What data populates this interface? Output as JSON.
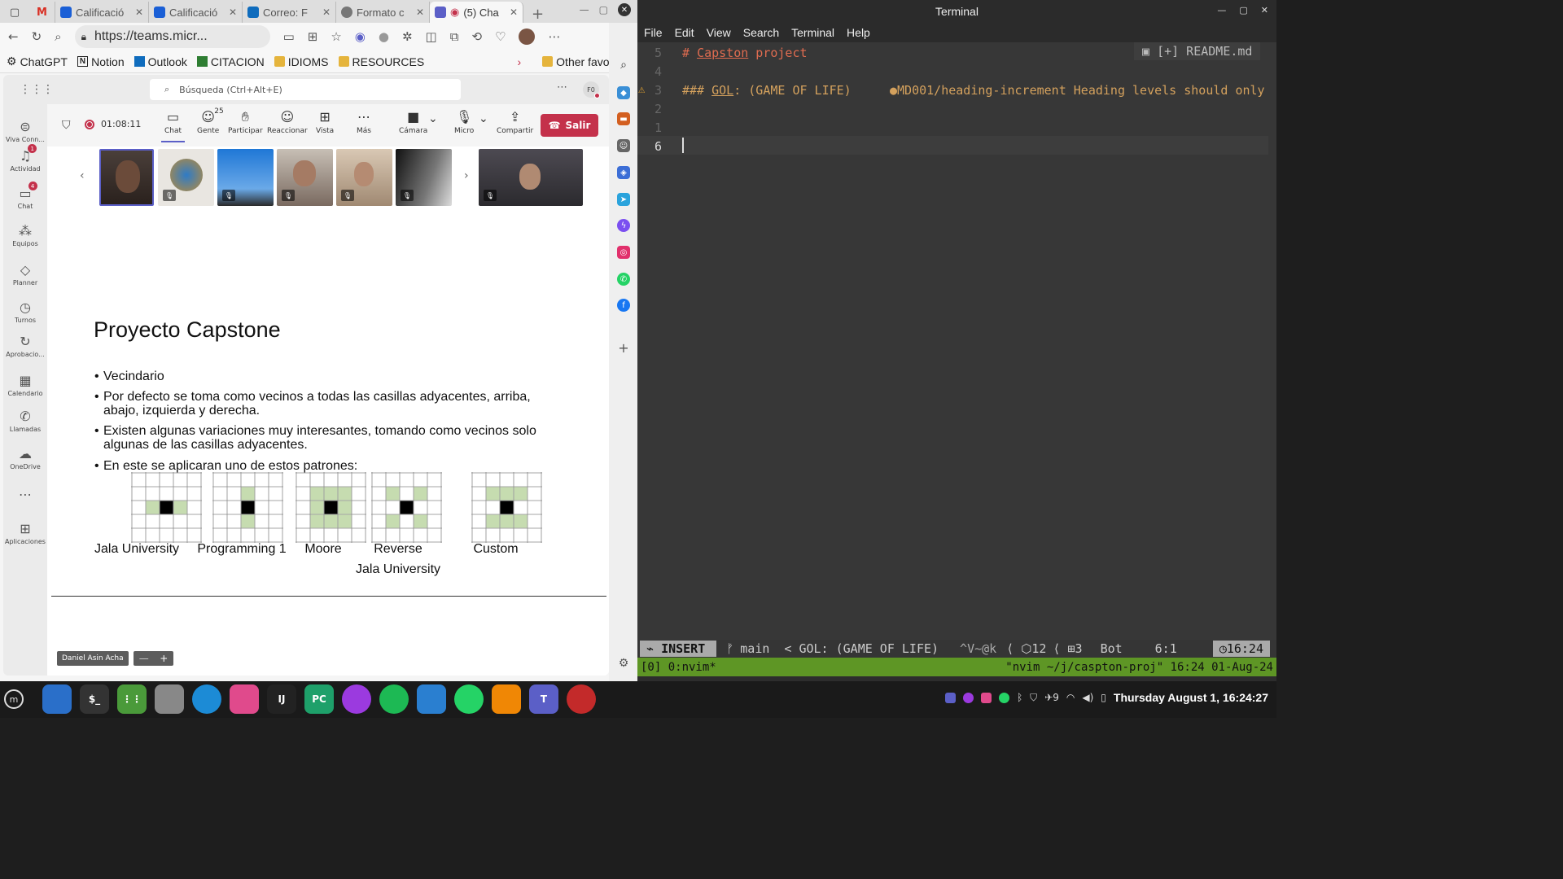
{
  "browser": {
    "tabs": [
      {
        "label": "Calificació",
        "color": "#1a5fd6"
      },
      {
        "label": "Calificació",
        "color": "#1a5fd6"
      },
      {
        "label": "Correo: F",
        "color": "#0f6cbd"
      },
      {
        "label": "Formato c",
        "color": "#777"
      },
      {
        "label": "(5) Cha",
        "color": "#5b5fc7"
      }
    ],
    "url": "https://teams.micr...",
    "favorites": [
      "ChatGPT",
      "Notion",
      "Outlook",
      "CITACION",
      "IDIOMS",
      "RESOURCES"
    ],
    "other_favorites": "Other favorites"
  },
  "teams": {
    "search_placeholder": "Búsqueda (Ctrl+Alt+E)",
    "avatar_initials": "F0",
    "rail": [
      {
        "label": "Viva Conn...",
        "icon": "viva-icon"
      },
      {
        "label": "Actividad",
        "icon": "bell-icon",
        "badge": "1"
      },
      {
        "label": "Chat",
        "icon": "chat-icon",
        "badge": "4"
      },
      {
        "label": "Equipos",
        "icon": "teams-icon"
      },
      {
        "label": "Planner",
        "icon": "planner-icon"
      },
      {
        "label": "Turnos",
        "icon": "shifts-icon"
      },
      {
        "label": "Aprobacio...",
        "icon": "approvals-icon"
      },
      {
        "label": "Calendario",
        "icon": "calendar-icon"
      },
      {
        "label": "Llamadas",
        "icon": "phone-icon"
      },
      {
        "label": "OneDrive",
        "icon": "cloud-icon"
      },
      {
        "label": "",
        "icon": "more-icon"
      },
      {
        "label": "Aplicaciones",
        "icon": "apps-icon"
      }
    ],
    "timer": "01:08:11",
    "meeting_buttons": [
      {
        "label": "Chat",
        "icon": "chat-icon"
      },
      {
        "label": "Gente",
        "icon": "people-icon",
        "count": "25"
      },
      {
        "label": "Participar",
        "icon": "hand-icon"
      },
      {
        "label": "Reaccionar",
        "icon": "emoji-icon"
      },
      {
        "label": "Vista",
        "icon": "grid-icon"
      },
      {
        "label": "Más",
        "icon": "more-icon"
      },
      {
        "label": "Cámara",
        "icon": "camera-icon"
      },
      {
        "label": "Micro",
        "icon": "mic-off-icon"
      },
      {
        "label": "Compartir",
        "icon": "share-icon"
      }
    ],
    "leave_label": "Salir",
    "presenter_name": "Daniel Asin Acha"
  },
  "slide": {
    "title": "Proyecto Capstone",
    "bullets": [
      "Vecindario",
      "Por defecto se toma como vecinos a todas las casillas adyacentes, arriba, abajo, izquierda y derecha.",
      "Existen algunas variaciones muy interesantes, tomando como vecinos solo algunas de las casillas adyacentes.",
      "En este se aplicaran uno de estos patrones:"
    ],
    "patterns": [
      {
        "label": "Jala University",
        "cells": [
          0,
          0,
          0,
          1,
          2,
          1,
          0,
          0,
          0
        ]
      },
      {
        "label": "Programming 1",
        "cells": [
          0,
          1,
          0,
          0,
          2,
          0,
          0,
          1,
          0
        ]
      },
      {
        "label": "Moore",
        "cells": [
          1,
          1,
          1,
          1,
          2,
          1,
          1,
          1,
          1
        ]
      },
      {
        "label": "Reverse\nJala University",
        "cells": [
          1,
          0,
          1,
          0,
          2,
          0,
          1,
          0,
          1
        ]
      },
      {
        "label": "Custom",
        "cells": [
          1,
          1,
          1,
          0,
          2,
          0,
          1,
          1,
          1
        ]
      }
    ],
    "neighbor_color": "#c6dcb0",
    "center_color": "#000000"
  },
  "terminal": {
    "title": "Terminal",
    "menu": [
      "File",
      "Edit",
      "View",
      "Search",
      "Terminal",
      "Help"
    ],
    "lines": [
      {
        "num": "5",
        "text_hash": "# ",
        "text_word": "Capston",
        "text_rest": " project"
      },
      {
        "num": "4",
        "text_hash": "",
        "text_word": "",
        "text_rest": ""
      },
      {
        "num": "3",
        "text_hash": "### ",
        "text_word": "GOL",
        "text_rest": ": (GAME OF LIFE)"
      },
      {
        "num": "2",
        "text_hash": "",
        "text_word": "",
        "text_rest": ""
      },
      {
        "num": "1",
        "text_hash": "",
        "text_word": "",
        "text_rest": ""
      },
      {
        "num": "6",
        "text_hash": "",
        "text_word": "",
        "text_rest": ""
      }
    ],
    "readme_tab": "[+] README.md",
    "lint_message": "●MD001/heading-increment Heading levels should only",
    "status": {
      "mode": "INSERT",
      "branch": "main",
      "section": "< GOL: (GAME OF LIFE)",
      "keys": "^V~@k",
      "count1": "12",
      "count2": "3",
      "pos": "Bot",
      "cursor": "6:1",
      "time": "16:24"
    },
    "tmux_left": "[0] 0:nvim*",
    "tmux_right": "\"nvim ~/j/caspton-proj\" 16:24 01-Aug-24"
  },
  "taskbar": {
    "apps": [
      {
        "name": "files",
        "color": "#2a6fc9",
        "text": ""
      },
      {
        "name": "terminal",
        "color": "#333",
        "text": "$_"
      },
      {
        "name": "app-grid",
        "color": "#4a9a3a",
        "text": "⋮⋮"
      },
      {
        "name": "settings",
        "color": "#888",
        "text": ""
      },
      {
        "name": "edge",
        "color": "#1c8bd6",
        "text": ""
      },
      {
        "name": "jetbrains-toolbox",
        "color": "#e04a8c",
        "text": ""
      },
      {
        "name": "intellij",
        "color": "#222",
        "text": "IJ"
      },
      {
        "name": "pycharm",
        "color": "#1ea06a",
        "text": "PC"
      },
      {
        "name": "firefox",
        "color": "#9b3adf",
        "text": ""
      },
      {
        "name": "spotify",
        "color": "#1db954",
        "text": ""
      },
      {
        "name": "monitor",
        "color": "#2a7fd0",
        "text": ""
      },
      {
        "name": "whatsapp",
        "color": "#25d366",
        "text": ""
      },
      {
        "name": "drawio",
        "color": "#f08705",
        "text": ""
      },
      {
        "name": "teams",
        "color": "#5b5fc7",
        "text": "T"
      },
      {
        "name": "recorder",
        "color": "#c32a2a",
        "text": ""
      }
    ],
    "tray_count": "9",
    "datetime": "Thursday August  1, 16:24:27"
  }
}
